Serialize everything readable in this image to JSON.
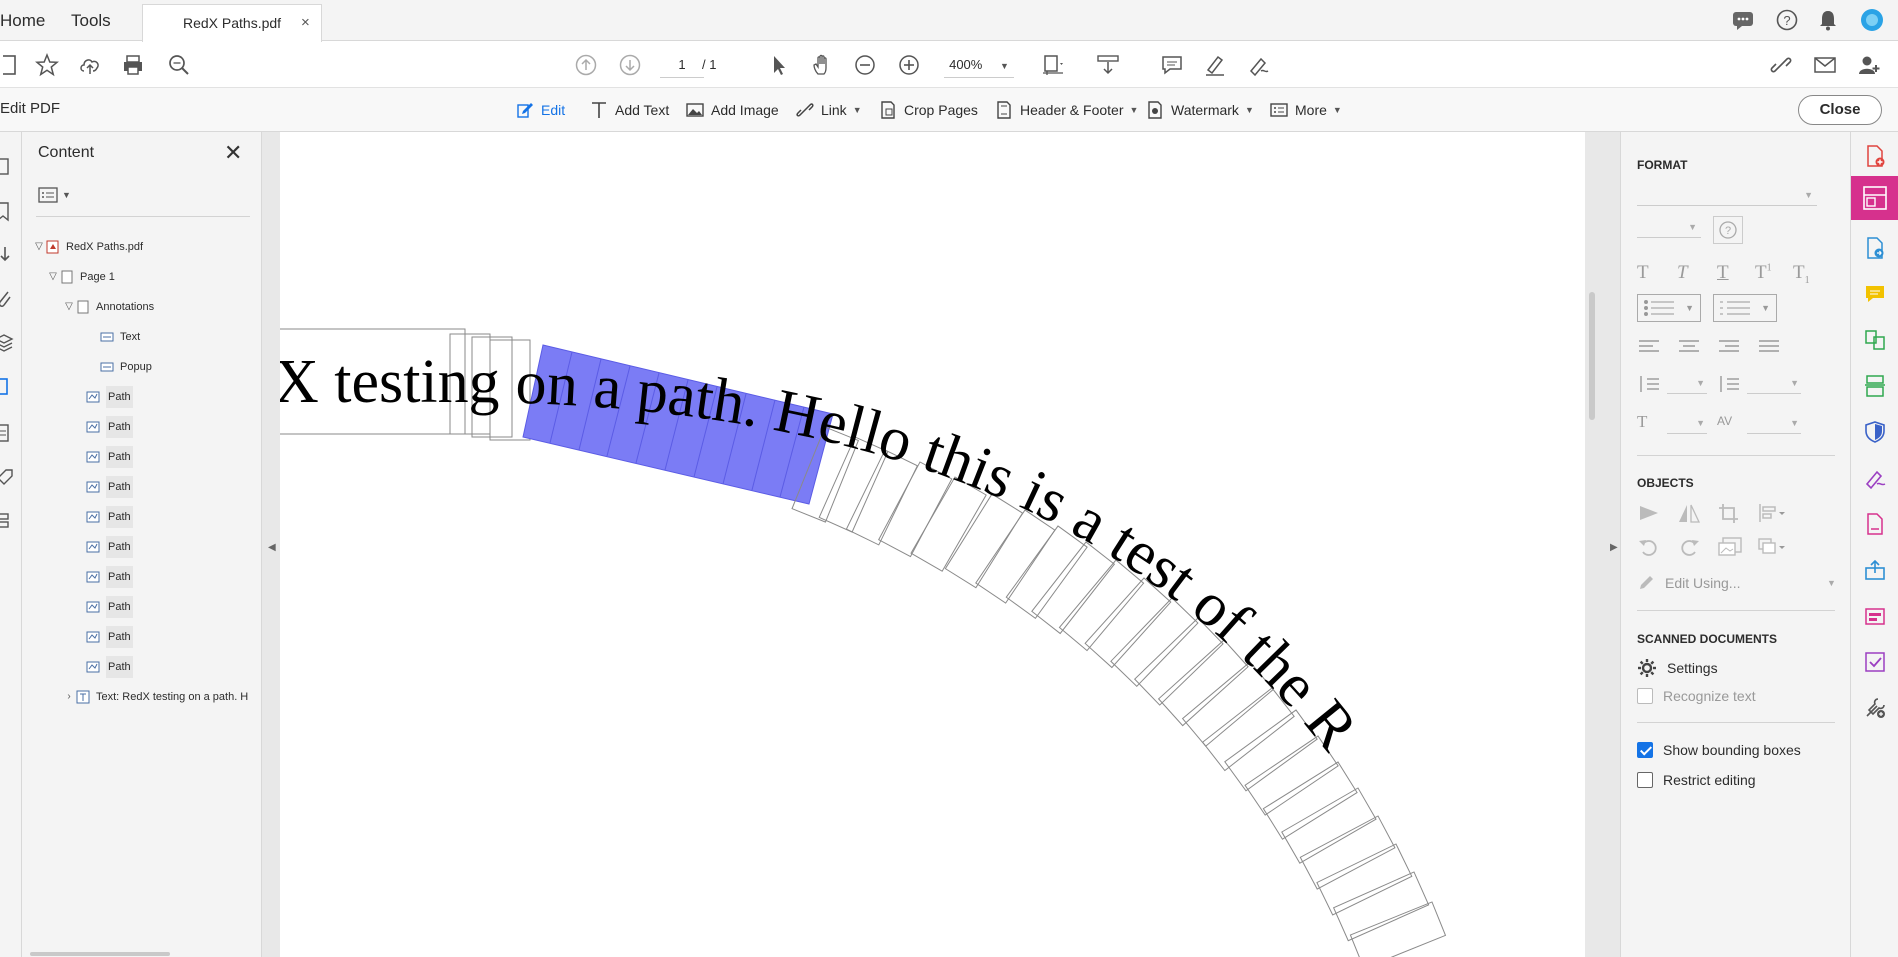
{
  "tabs": {
    "home": "Home",
    "tools": "Tools",
    "file": "RedX Paths.pdf",
    "close_x": "×"
  },
  "toolbar": {
    "page_current": "1",
    "page_total": "/ 1",
    "zoom": "400%"
  },
  "editbar": {
    "title": "Edit PDF",
    "edit": "Edit",
    "add_text": "Add Text",
    "add_image": "Add Image",
    "link": "Link",
    "crop_pages": "Crop Pages",
    "header_footer": "Header & Footer",
    "watermark": "Watermark",
    "more": "More",
    "close": "Close"
  },
  "content_panel": {
    "title": "Content",
    "tree": {
      "file": "RedX Paths.pdf",
      "page": "Page 1",
      "annotations": "Annotations",
      "annot_items": [
        "Text",
        "Popup"
      ],
      "paths": [
        "Path",
        "Path",
        "Path",
        "Path",
        "Path",
        "Path",
        "Path",
        "Path",
        "Path",
        "Path"
      ],
      "text_node": "Text: RedX testing on a path. H"
    }
  },
  "document": {
    "curved_text": "X testing on a path. Hello this is a test of the R",
    "highlight_color": "#7b7cf5"
  },
  "format_panel": {
    "format_title": "FORMAT",
    "objects_title": "OBJECTS",
    "edit_using": "Edit Using...",
    "scanned_title": "SCANNED DOCUMENTS",
    "settings": "Settings",
    "recognize_text": "Recognize text",
    "show_bounding_boxes": "Show bounding boxes",
    "restrict_editing": "Restrict editing"
  },
  "colors": {
    "accent": "#1473e6",
    "edit_pink": "#d6318d"
  }
}
